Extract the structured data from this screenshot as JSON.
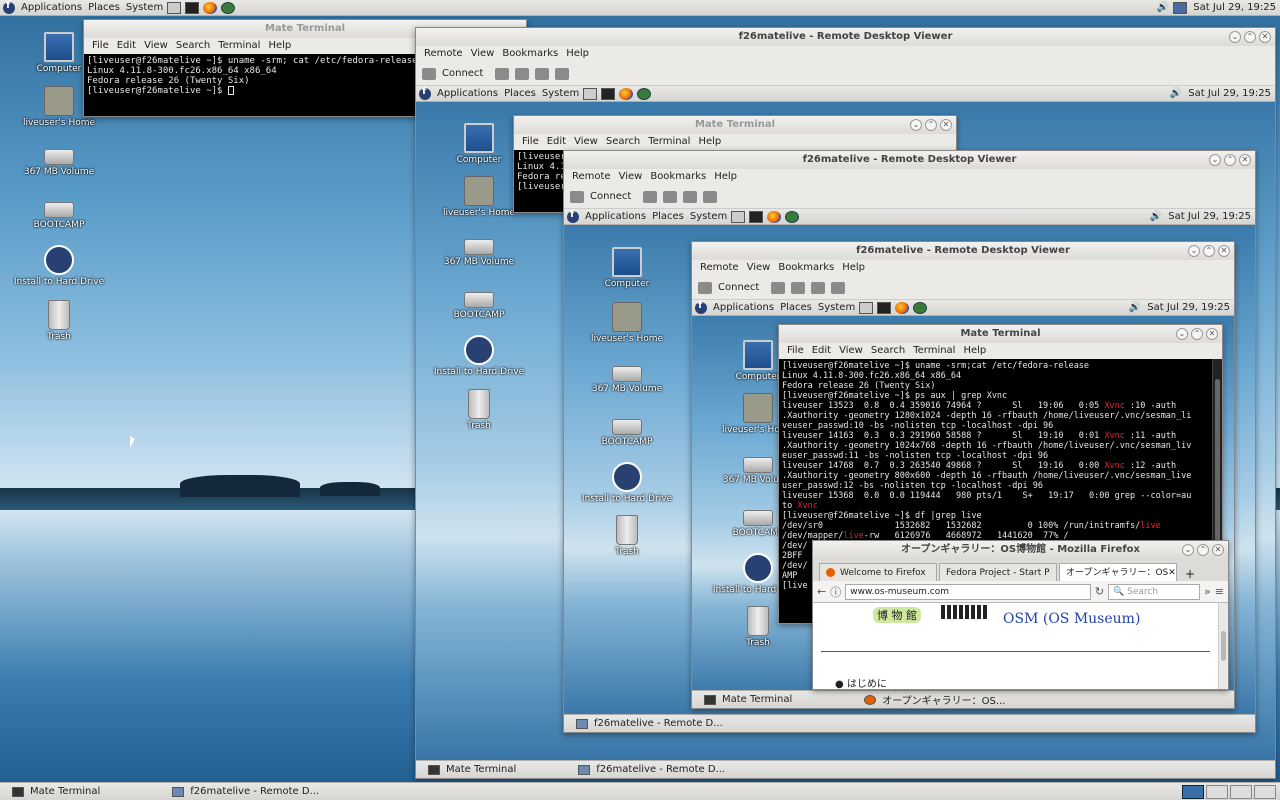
{
  "top_panel": {
    "menus": [
      "Applications",
      "Places",
      "System"
    ],
    "clock": "Sat Jul 29, 19:25"
  },
  "bottom_panel": {
    "tasks": [
      "Mate Terminal",
      "f26matelive - Remote D..."
    ]
  },
  "desktop_icons": [
    "Computer",
    "liveuser's Home",
    "367 MB Volume",
    "BOOTCAMP",
    "Install to Hard Drive",
    "Trash"
  ],
  "terminal1": {
    "title": "Mate Terminal",
    "menu": [
      "File",
      "Edit",
      "View",
      "Search",
      "Terminal",
      "Help"
    ],
    "lines": [
      "[liveuser@f26matelive ~]$ uname -srm; cat /etc/fedora-release",
      "Linux 4.11.8-300.fc26.x86_64 x86_64",
      "Fedora release 26 (Twenty Six)",
      "[liveuser@f26matelive ~]$ "
    ]
  },
  "rdv": {
    "title": "f26matelive - Remote Desktop Viewer",
    "menu": [
      "Remote",
      "View",
      "Bookmarks",
      "Help"
    ],
    "connect": "Connect"
  },
  "terminal2": {
    "title": "Mate Terminal",
    "lines": [
      "[liveuser@f26matelive ~]$ uname -srm;cat /etc/fedora-release",
      "Linux 4.11.8-300.fc26.x86_64 x86_64",
      "Fedora release 26 (Twenty Six)",
      "[liveuser@f26matelive ~]$ ps aux | grep Xvnc",
      "liveuser 13523  0.8  0.4 359016 74964 ?      Sl   19:06   0:05 Xvnc :10 -auth",
      ".Xauthority -geometry 1280x1024 -depth 16 -rfbauth /home/liveuser/.vnc/sesman_li",
      "veuser_passwd:10 -bs -nolisten tcp -localhost -dpi 96",
      "liveuser 14163  0.3  0.3 291960 58588 ?      Sl   19:10   0:01 Xvnc :11 -auth",
      ".Xauthority -geometry 1024x768 -depth 16 -rfbauth /home/liveuser/.vnc/sesman_liv",
      "euser_passwd:11 -bs -nolisten tcp -localhost -dpi 96",
      "liveuser 14768  0.7  0.3 263540 49868 ?      Sl   19:16   0:00 Xvnc :12 -auth",
      ".Xauthority -geometry 800x600 -depth 16 -rfbauth /home/liveuser/.vnc/sesman_live",
      "user_passwd:12 -bs -nolisten tcp -localhost -dpi 96",
      "liveuser 15368  0.0  0.0 119444   980 pts/1    S+   19:17   0:00 grep --color=au",
      "to Xvnc",
      "[liveuser@f26matelive ~]$ df |grep live",
      "/dev/sr0              1532682   1532682         0 100% /run/initramfs/live",
      "/dev/mapper/live-rw   6126976   4668972   1441620  77% /",
      "/dev/",
      "2BFF",
      "/dev/",
      "AMP",
      "[live"
    ]
  },
  "firefox": {
    "title": "オープンギャラリー：OS博物館 - Mozilla Firefox",
    "tabs": [
      "Welcome to Firefox",
      "Fedora Project - Start P",
      "オープンギャラリー：OS"
    ],
    "url": "www.os-museum.com",
    "search_placeholder": "Search",
    "logo_text": "博 物 館",
    "heading": "OSM (OS Museum)",
    "list_item": "はじめに"
  },
  "task_firefox": "オープンギャラリー：OS..."
}
